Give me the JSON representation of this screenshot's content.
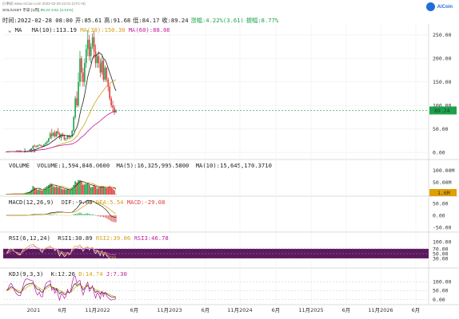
{
  "header": {
    "source_line": "价事如 www.AiCoin.com   2022-02-28 22:01 (UTC+8)",
    "pair": "SOL/USDT 币安 [1周]",
    "price": "89.24",
    "change": "3.61 (4.21%)",
    "logo_text": "AiCoin"
  },
  "ohlc": {
    "time": "时间:2022-02-28 08:00",
    "open": "开:85.61",
    "high": "高:91.68",
    "low": "低:84.17",
    "close": "收:89.24",
    "change": "涨幅:4.22%(3.61)",
    "amplitude": "振幅:8.77%"
  },
  "main_indicator": {
    "name": "MA",
    "ma10": "MA(10):113.19",
    "ma30": "MA(30):150.30",
    "ma60": "MA(60):88.08"
  },
  "volume_indicator": {
    "name": "VOLUME",
    "volume": "VOLUME:1,594,846.0600",
    "ma5": "MA(5):16,325,995.5800",
    "ma10": "MA(10):15,645,170.3710"
  },
  "macd_indicator": {
    "name": "MACD(12,26,9)",
    "dif": "DIF:-9.00",
    "dea": "DEA:5.54",
    "macd": "MACD:-29.08"
  },
  "rsi_indicator": {
    "name": "RSI(6,12,24)",
    "rsi1": "RSI1:30.89",
    "rsi2": "RSI2:39.06",
    "rsi3": "RSI3:46.78"
  },
  "kdj_indicator": {
    "name": "KDJ(9,3,3)",
    "k": "K:12.26",
    "d": "D:14.74",
    "j": "J:7.30"
  },
  "colors": {
    "up": "#1aa34a",
    "down": "#e23b3b",
    "ma10": "#222222",
    "ma30": "#d4a017",
    "ma60": "#c2189a",
    "rsi_band": "#5c1a5e",
    "price_tag": "#1aa34a",
    "vol_tag": "#e0a000"
  },
  "chart_data": {
    "type": "candlestick",
    "x_ticks": [
      "2021",
      "6月",
      "11月2022",
      "6月",
      "11月2023",
      "6月",
      "11月2024",
      "6月",
      "11月2025",
      "6月",
      "11月2026",
      "6月"
    ],
    "price_axis_ticks": [
      "250.00",
      "200.00",
      "150.00",
      "100.00",
      "50.00",
      "0.00"
    ],
    "price_ylim": [
      -10,
      270
    ],
    "last_price_label": "89.24",
    "low_annotation": "1.03",
    "ohlc": [
      [
        1.5,
        1.6,
        1.2,
        1.4
      ],
      [
        1.4,
        1.7,
        1.3,
        1.6
      ],
      [
        1.6,
        2.1,
        1.5,
        2.0
      ],
      [
        2.0,
        2.6,
        1.9,
        2.4
      ],
      [
        2.4,
        2.7,
        2.0,
        2.2
      ],
      [
        2.2,
        2.4,
        1.9,
        2.0
      ],
      [
        2.0,
        2.2,
        1.7,
        1.9
      ],
      [
        1.9,
        2.1,
        1.6,
        1.8
      ],
      [
        1.8,
        2.0,
        1.5,
        1.6
      ],
      [
        1.6,
        1.8,
        1.4,
        1.5
      ],
      [
        1.5,
        1.9,
        1.4,
        1.8
      ],
      [
        1.8,
        2.4,
        1.7,
        2.3
      ],
      [
        2.3,
        3.2,
        2.2,
        3.0
      ],
      [
        3.0,
        3.6,
        2.6,
        3.4
      ],
      [
        3.4,
        4.3,
        3.2,
        4.0
      ],
      [
        4.0,
        6.5,
        3.8,
        6.0
      ],
      [
        6.0,
        9.0,
        5.5,
        8.5
      ],
      [
        8.5,
        15,
        8,
        14
      ],
      [
        14,
        17,
        11,
        13
      ],
      [
        13,
        15,
        10,
        12
      ],
      [
        12,
        16,
        11,
        15
      ],
      [
        15,
        18,
        14,
        16
      ],
      [
        16,
        16.5,
        13,
        14
      ],
      [
        14,
        15,
        12,
        13
      ],
      [
        13,
        18,
        12,
        17
      ],
      [
        17,
        22,
        15,
        20
      ],
      [
        20,
        26,
        17,
        23
      ],
      [
        23,
        31,
        21,
        30
      ],
      [
        30,
        44,
        28,
        40
      ],
      [
        40,
        50,
        28,
        35
      ],
      [
        35,
        44,
        33,
        42
      ],
      [
        42,
        47,
        30,
        34
      ],
      [
        34,
        46,
        33,
        45
      ],
      [
        45,
        52,
        38,
        40
      ],
      [
        40,
        43,
        28,
        31
      ],
      [
        31,
        41,
        25,
        38
      ],
      [
        38,
        42,
        33,
        35
      ],
      [
        35,
        37,
        25,
        28
      ],
      [
        28,
        31,
        24,
        30
      ],
      [
        30,
        37,
        27,
        35
      ],
      [
        35,
        38,
        28,
        32
      ],
      [
        32,
        36,
        29,
        34
      ],
      [
        34,
        48,
        32,
        46
      ],
      [
        46,
        78,
        44,
        75
      ],
      [
        75,
        120,
        70,
        115
      ],
      [
        115,
        130,
        95,
        100
      ],
      [
        100,
        170,
        97,
        150
      ],
      [
        150,
        216,
        140,
        200
      ],
      [
        200,
        205,
        150,
        170
      ],
      [
        170,
        180,
        140,
        150
      ],
      [
        150,
        200,
        140,
        190
      ],
      [
        190,
        230,
        180,
        220
      ],
      [
        220,
        260,
        205,
        240
      ],
      [
        240,
        250,
        195,
        205
      ],
      [
        205,
        232,
        190,
        225
      ],
      [
        225,
        253,
        220,
        245
      ],
      [
        245,
        258,
        200,
        215
      ],
      [
        215,
        230,
        180,
        190
      ],
      [
        190,
        210,
        180,
        205
      ],
      [
        205,
        215,
        180,
        190
      ],
      [
        190,
        200,
        160,
        170
      ],
      [
        170,
        205,
        165,
        195
      ],
      [
        195,
        200,
        150,
        155
      ],
      [
        155,
        185,
        150,
        180
      ],
      [
        180,
        182,
        150,
        155
      ],
      [
        155,
        160,
        130,
        140
      ],
      [
        140,
        145,
        110,
        115
      ],
      [
        115,
        120,
        95,
        100
      ],
      [
        100,
        110,
        85,
        95
      ],
      [
        95,
        100,
        80,
        85
      ],
      [
        85,
        92,
        84,
        89
      ]
    ],
    "volume": {
      "axis_ticks": [
        "100.00M",
        "50.00M"
      ],
      "ylim": [
        0,
        125
      ],
      "last_label": "1.6M",
      "values": [
        2,
        2,
        3,
        3,
        3,
        3,
        3,
        3,
        3,
        3,
        4,
        5,
        7,
        9,
        10,
        14,
        20,
        35,
        30,
        25,
        20,
        22,
        18,
        17,
        25,
        30,
        35,
        40,
        45,
        45,
        35,
        30,
        35,
        30,
        30,
        25,
        22,
        22,
        20,
        22,
        20,
        20,
        30,
        40,
        55,
        50,
        60,
        60,
        55,
        40,
        42,
        45,
        48,
        40,
        30,
        32,
        40,
        33,
        25,
        28,
        30,
        35,
        35,
        30,
        28,
        30,
        35,
        30,
        25,
        18,
        2
      ]
    },
    "macd": {
      "axis_ticks": [
        "50.00",
        "0.00",
        "-50.00"
      ],
      "ylim": [
        -60,
        60
      ],
      "hist": [
        0,
        0,
        0,
        0,
        0,
        0,
        0,
        0,
        0,
        0,
        0,
        0.1,
        0.2,
        0.3,
        0.4,
        0.6,
        1,
        1.5,
        1.2,
        0.8,
        0.6,
        0.5,
        0.3,
        0.2,
        0.5,
        0.8,
        1.2,
        1.8,
        3,
        2.5,
        2.2,
        1.5,
        1.8,
        1.2,
        0.5,
        0.8,
        0.4,
        -0.5,
        -0.8,
        -0.3,
        -0.5,
        -0.2,
        1.2,
        4,
        7,
        6,
        9,
        12,
        9,
        5,
        6,
        8,
        9,
        6,
        4,
        4,
        3,
        -2,
        -3,
        -4,
        -6,
        -5,
        -8,
        -9,
        -12,
        -16,
        -20,
        -25,
        -27,
        -29,
        -29.08
      ],
      "dif": [
        0,
        0,
        0,
        0,
        0,
        0,
        0,
        0,
        0,
        0,
        0.1,
        0.2,
        0.3,
        0.5,
        0.7,
        1.1,
        1.8,
        3,
        3.5,
        3.6,
        3.8,
        4,
        4.1,
        4.1,
        4.4,
        5,
        6,
        7.5,
        10,
        11,
        12,
        12.5,
        13.5,
        14,
        13.5,
        14,
        13.5,
        12.5,
        12,
        12,
        11.5,
        11.5,
        13,
        17,
        24,
        30,
        38,
        47,
        52,
        53,
        55,
        59,
        63,
        62,
        60,
        60,
        58,
        52,
        49,
        46,
        41,
        38,
        32,
        27,
        21,
        13,
        4,
        -3,
        -6,
        -8,
        -9
      ],
      "dea": [
        0,
        0,
        0,
        0,
        0,
        0,
        0,
        0,
        0,
        0,
        0,
        0.1,
        0.2,
        0.3,
        0.5,
        0.7,
        1,
        1.5,
        2,
        2.4,
        2.8,
        3.2,
        3.5,
        3.8,
        4,
        4.3,
        4.8,
        5.5,
        6.5,
        7.6,
        8.6,
        9.5,
        10.3,
        11.1,
        11.6,
        12,
        12.3,
        12.4,
        12.4,
        12.3,
        12.2,
        12.1,
        12.2,
        13.2,
        15.5,
        18.4,
        22.3,
        27.3,
        32.2,
        36.4,
        40,
        43.8,
        47.7,
        50.8,
        52.7,
        54.1,
        55,
        54.4,
        53.3,
        51.9,
        49.5,
        47,
        43.5,
        39.6,
        35.1,
        30.1,
        24.8,
        19.8,
        15.2,
        11.4,
        5.54
      ]
    },
    "rsi": {
      "axis_ticks": [
        "100.00",
        "70.00",
        "50.00",
        "30.00"
      ],
      "ylim": [
        0,
        110
      ],
      "rsi1": [
        50,
        60,
        70,
        75,
        70,
        60,
        55,
        50,
        45,
        45,
        60,
        72,
        80,
        85,
        88,
        92,
        94,
        95,
        85,
        75,
        70,
        72,
        60,
        55,
        70,
        78,
        82,
        85,
        88,
        70,
        75,
        62,
        72,
        55,
        40,
        55,
        48,
        38,
        42,
        55,
        45,
        50,
        72,
        88,
        92,
        78,
        88,
        92,
        72,
        60,
        72,
        80,
        85,
        65,
        75,
        80,
        60,
        50,
        62,
        52,
        42,
        62,
        40,
        55,
        42,
        35,
        30,
        28,
        30,
        25,
        30.89
      ],
      "rsi2": [
        50,
        55,
        62,
        68,
        66,
        60,
        56,
        52,
        49,
        48,
        55,
        63,
        70,
        75,
        79,
        84,
        87,
        89,
        84,
        77,
        73,
        73,
        66,
        61,
        67,
        73,
        76,
        79,
        82,
        73,
        74,
        66,
        70,
        61,
        50,
        56,
        52,
        45,
        46,
        52,
        48,
        50,
        63,
        75,
        82,
        78,
        83,
        86,
        78,
        70,
        73,
        76,
        79,
        71,
        74,
        76,
        67,
        60,
        64,
        58,
        51,
        58,
        48,
        53,
        47,
        42,
        39,
        36,
        37,
        34,
        39.06
      ],
      "rsi3": [
        50,
        52,
        56,
        60,
        61,
        59,
        57,
        55,
        53,
        52,
        55,
        59,
        64,
        68,
        71,
        75,
        78,
        80,
        79,
        76,
        73,
        72,
        68,
        65,
        67,
        70,
        72,
        74,
        77,
        73,
        73,
        69,
        70,
        66,
        59,
        60,
        57,
        53,
        53,
        55,
        53,
        53,
        60,
        67,
        72,
        72,
        75,
        78,
        75,
        71,
        72,
        73,
        75,
        71,
        72,
        73,
        68,
        64,
        65,
        62,
        58,
        60,
        55,
        56,
        53,
        50,
        48,
        46,
        46,
        45,
        46.78
      ]
    },
    "kdj": {
      "axis_ticks": [
        "100.00",
        "50.00",
        "0.00"
      ],
      "ylim": [
        -20,
        115
      ],
      "k": [
        50,
        55,
        65,
        72,
        68,
        60,
        52,
        45,
        40,
        38,
        50,
        65,
        78,
        85,
        88,
        90,
        92,
        93,
        80,
        65,
        55,
        58,
        45,
        40,
        55,
        68,
        75,
        80,
        85,
        65,
        68,
        55,
        62,
        48,
        32,
        42,
        38,
        28,
        30,
        45,
        38,
        42,
        62,
        82,
        90,
        78,
        85,
        90,
        72,
        55,
        62,
        75,
        82,
        62,
        65,
        72,
        55,
        40,
        48,
        42,
        30,
        45,
        32,
        40,
        32,
        25,
        20,
        15,
        14,
        12,
        12.26
      ],
      "d": [
        50,
        52,
        57,
        62,
        64,
        63,
        59,
        54,
        49,
        46,
        47,
        53,
        61,
        69,
        75,
        80,
        84,
        87,
        85,
        78,
        70,
        66,
        59,
        53,
        54,
        59,
        64,
        69,
        74,
        71,
        70,
        65,
        64,
        59,
        50,
        47,
        44,
        39,
        36,
        39,
        39,
        40,
        47,
        59,
        69,
        72,
        76,
        81,
        78,
        70,
        67,
        70,
        74,
        70,
        68,
        69,
        64,
        56,
        53,
        49,
        43,
        44,
        40,
        40,
        37,
        33,
        29,
        24,
        21,
        18,
        14.74
      ],
      "j": [
        50,
        61,
        81,
        92,
        76,
        54,
        38,
        27,
        22,
        22,
        56,
        89,
        112,
        117,
        114,
        110,
        108,
        105,
        70,
        39,
        25,
        42,
        17,
        14,
        57,
        86,
        97,
        102,
        107,
        53,
        64,
        35,
        58,
        26,
        -4,
        32,
        26,
        6,
        18,
        57,
        36,
        46,
        92,
        128,
        132,
        90,
        103,
        108,
        60,
        25,
        52,
        85,
        98,
        46,
        59,
        78,
        37,
        8,
        38,
        28,
        4,
        47,
        16,
        40,
        22,
        9,
        2,
        -3,
        0,
        0,
        7.3
      ]
    }
  }
}
